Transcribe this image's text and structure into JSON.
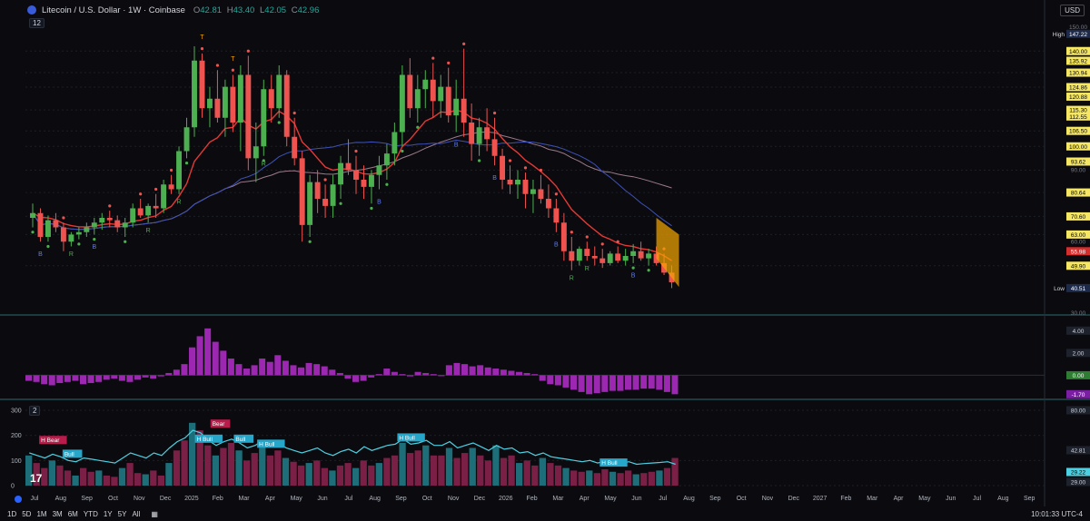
{
  "header": {
    "symbol_title": "Litecoin / U.S. Dollar · 1W · Coinbase",
    "ohlc": [
      {
        "label": "O",
        "value": "42.81"
      },
      {
        "label": "H",
        "value": "43.40"
      },
      {
        "label": "L",
        "value": "42.05"
      },
      {
        "label": "C",
        "value": "42.96"
      }
    ],
    "interval_count": "12",
    "currency": "USD"
  },
  "pane3_count": "2",
  "timeframes": [
    "1D",
    "5D",
    "1M",
    "3M",
    "6M",
    "YTD",
    "1Y",
    "5Y",
    "All"
  ],
  "clock": "10:01:33 UTC-4",
  "colors": {
    "up": "#4caf50",
    "down": "#ef5350",
    "ema_red": "#e53935",
    "sma_blue": "#3f51b5",
    "ema_mauve": "#9c7a8a",
    "osc_purple": "#9c27b0",
    "cyan": "#4dd0e1",
    "orange": "#f7a600"
  },
  "chart_data": [
    {
      "type": "line",
      "title": "Litecoin / U.S. Dollar · 1W · Coinbase",
      "x_tick_labels": [
        "Jul",
        "Aug",
        "Sep",
        "Oct",
        "Nov",
        "Dec",
        "2025",
        "Feb",
        "Mar",
        "Apr",
        "May",
        "Jun",
        "Jul",
        "Aug",
        "Sep",
        "Oct",
        "Nov",
        "Dec",
        "2026",
        "Feb",
        "Mar",
        "Apr",
        "May",
        "Jun",
        "Jul",
        "Aug",
        "Sep",
        "Oct",
        "Nov",
        "Dec",
        "2027",
        "Feb",
        "Mar",
        "Apr",
        "May",
        "Jun",
        "Jul",
        "Aug",
        "Sep"
      ],
      "y_tick_labels": [
        "150.00",
        "140.00",
        "130.94",
        "124.86",
        "115.30",
        "106.50",
        "100.00",
        "90.00",
        "80.64",
        "70.60",
        "63.00",
        "60.00",
        "55.98",
        "49.90",
        "40.51",
        "30.00"
      ],
      "ylim": [
        30,
        150
      ],
      "price_labels": [
        {
          "label": "High",
          "value": "147.22"
        },
        {
          "label": "",
          "value": "140.00"
        },
        {
          "label": "",
          "value": "135.92"
        },
        {
          "label": "",
          "value": "130.94"
        },
        {
          "label": "",
          "value": "124.86"
        },
        {
          "label": "",
          "value": "120.88"
        },
        {
          "label": "",
          "value": "115.30"
        },
        {
          "label": "",
          "value": "112.55"
        },
        {
          "label": "",
          "value": "106.50"
        },
        {
          "label": "",
          "value": "100.00"
        },
        {
          "label": "",
          "value": "93.62"
        },
        {
          "label": "",
          "value": "80.64"
        },
        {
          "label": "",
          "value": "70.60"
        },
        {
          "label": "",
          "value": "63.00"
        },
        {
          "label": "",
          "value": "55.98"
        },
        {
          "label": "",
          "value": "49.90"
        },
        {
          "label": "Low",
          "value": "40.51"
        }
      ],
      "series": [
        {
          "type": "candlestick",
          "candles": [
            [
              70,
              76,
              66,
              72
            ],
            [
              72,
              74,
              60,
              62
            ],
            [
              62,
              71,
              60,
              69
            ],
            [
              69,
              72,
              64,
              66
            ],
            [
              66,
              68,
              56,
              60
            ],
            [
              60,
              64,
              58,
              63
            ],
            [
              63,
              66,
              61,
              64
            ],
            [
              64,
              68,
              62,
              66
            ],
            [
              66,
              70,
              63,
              68
            ],
            [
              68,
              72,
              65,
              70
            ],
            [
              70,
              73,
              66,
              69
            ],
            [
              69,
              71,
              64,
              66
            ],
            [
              66,
              70,
              62,
              68
            ],
            [
              68,
              76,
              66,
              74
            ],
            [
              74,
              78,
              70,
              71
            ],
            [
              71,
              76,
              68,
              75
            ],
            [
              75,
              80,
              70,
              74
            ],
            [
              74,
              86,
              72,
              84
            ],
            [
              84,
              88,
              80,
              82
            ],
            [
              82,
              100,
              80,
              98
            ],
            [
              98,
              112,
              95,
              108
            ],
            [
              108,
              142,
              104,
              136
            ],
            [
              136,
              139,
              112,
              116
            ],
            [
              116,
              125,
              108,
              120
            ],
            [
              120,
              132,
              110,
              112
            ],
            [
              112,
              128,
              104,
              125
            ],
            [
              125,
              130,
              106,
              110
            ],
            [
              110,
              134,
              98,
              130
            ],
            [
              130,
              138,
              90,
              95
            ],
            [
              95,
              110,
              85,
              100
            ],
            [
              100,
              128,
              96,
              124
            ],
            [
              124,
              130,
              110,
              116
            ],
            [
              116,
              134,
              112,
              130
            ],
            [
              130,
              132,
              100,
              104
            ],
            [
              104,
              112,
              92,
              95
            ],
            [
              95,
              98,
              60,
              67
            ],
            [
              67,
              88,
              62,
              85
            ],
            [
              85,
              90,
              72,
              78
            ],
            [
              78,
              84,
              70,
              75
            ],
            [
              75,
              88,
              70,
              84
            ],
            [
              84,
              96,
              78,
              93
            ],
            [
              93,
              103,
              88,
              90
            ],
            [
              90,
              96,
              80,
              86
            ],
            [
              86,
              92,
              78,
              83
            ],
            [
              83,
              90,
              76,
              88
            ],
            [
              88,
              96,
              82,
              92
            ],
            [
              92,
              101,
              86,
              97
            ],
            [
              97,
              110,
              92,
              106
            ],
            [
              106,
              134,
              100,
              130
            ],
            [
              130,
              137,
              112,
              116
            ],
            [
              116,
              130,
              110,
              124
            ],
            [
              124,
              132,
              116,
              128
            ],
            [
              128,
              135,
              112,
              119
            ],
            [
              119,
              130,
              112,
              125
            ],
            [
              125,
              133,
              110,
              113
            ],
            [
              113,
              128,
              106,
              120
            ],
            [
              120,
              141,
              104,
              110
            ],
            [
              110,
              118,
              94,
              101
            ],
            [
              101,
              112,
              96,
              108
            ],
            [
              108,
              116,
              98,
              103
            ],
            [
              103,
              112,
              92,
              96
            ],
            [
              96,
              99,
              82,
              86
            ],
            [
              86,
              92,
              80,
              84
            ],
            [
              84,
              90,
              78,
              86
            ],
            [
              86,
              89,
              74,
              80
            ],
            [
              80,
              86,
              72,
              82
            ],
            [
              82,
              88,
              76,
              78
            ],
            [
              78,
              84,
              70,
              74
            ],
            [
              74,
              78,
              64,
              68
            ],
            [
              68,
              72,
              52,
              56
            ],
            [
              56,
              62,
              48,
              52
            ],
            [
              52,
              58,
              50,
              57
            ],
            [
              57,
              60,
              52,
              54
            ],
            [
              54,
              58,
              50,
              53
            ],
            [
              53,
              57,
              49,
              51
            ],
            [
              51,
              56,
              50,
              55
            ],
            [
              55,
              58,
              51,
              52
            ],
            [
              52,
              57,
              50,
              54
            ],
            [
              54,
              59,
              51,
              56
            ],
            [
              56,
              60,
              52,
              53
            ],
            [
              53,
              57,
              50,
              55
            ],
            [
              55,
              58,
              50,
              51
            ],
            [
              51,
              55,
              46,
              47
            ],
            [
              47,
              50,
              40.51,
              42.96
            ]
          ]
        },
        {
          "name": "EMA",
          "values": []
        },
        {
          "name": "SMA",
          "values": []
        }
      ],
      "annotations": [
        "R",
        "T",
        "R",
        "B",
        "R",
        "B",
        "B",
        "B",
        "R",
        "B",
        "R",
        "T",
        "B",
        "B",
        "R"
      ]
    },
    {
      "type": "bar",
      "y_tick_labels": [
        "4.00",
        "2.00",
        "0.00",
        "-1.70"
      ],
      "ylim": [
        -2,
        5
      ],
      "values": [
        -0.5,
        -0.6,
        -0.8,
        -0.9,
        -0.7,
        -0.6,
        -0.5,
        -0.8,
        -0.7,
        -0.6,
        -0.4,
        -0.3,
        -0.5,
        -0.6,
        -0.4,
        -0.2,
        -0.3,
        -0.1,
        0.2,
        0.5,
        1.0,
        2.5,
        3.5,
        4.2,
        3.0,
        2.2,
        1.5,
        1.0,
        0.6,
        0.9,
        1.5,
        1.2,
        1.8,
        1.3,
        0.9,
        0.7,
        1.1,
        1.0,
        0.8,
        0.5,
        0.2,
        -0.3,
        -0.6,
        -0.5,
        -0.2,
        0.1,
        0.6,
        0.3,
        0.1,
        -0.1,
        0.3,
        0.2,
        0.1,
        0.0,
        0.9,
        1.1,
        1.0,
        0.8,
        0.9,
        0.7,
        0.6,
        0.5,
        0.4,
        0.3,
        0.2,
        0.1,
        -0.5,
        -0.8,
        -0.9,
        -1.1,
        -1.3,
        -1.5,
        -1.7,
        -1.6,
        -1.5,
        -1.4,
        -1.4,
        -1.3,
        -1.3,
        -1.2,
        -1.2,
        -1.3,
        -1.5,
        -1.7
      ]
    },
    {
      "type": "bar",
      "y_tick_labels": [
        "80.00",
        "42.81",
        "29.22",
        "29.00"
      ],
      "y_tick_labels_left": [
        "300",
        "200",
        "100",
        "0"
      ],
      "ylim": [
        0,
        300
      ],
      "labels": [
        "H Bear",
        "Bull",
        "Bear",
        "H Bull",
        "Bull",
        "H Bull",
        "H Bull",
        "H Bull"
      ],
      "values": [
        120,
        90,
        70,
        100,
        80,
        60,
        40,
        70,
        55,
        60,
        40,
        35,
        70,
        90,
        50,
        45,
        60,
        40,
        90,
        140,
        180,
        250,
        220,
        160,
        120,
        150,
        170,
        140,
        100,
        130,
        160,
        120,
        140,
        110,
        95,
        80,
        90,
        100,
        70,
        60,
        80,
        90,
        70,
        100,
        80,
        90,
        110,
        120,
        170,
        130,
        140,
        160,
        120,
        120,
        150,
        110,
        130,
        150,
        120,
        100,
        160,
        110,
        120,
        90,
        100,
        80,
        110,
        90,
        80,
        70,
        60,
        55,
        60,
        50,
        65,
        55,
        50,
        60,
        45,
        50,
        55,
        60,
        70,
        110
      ],
      "line": [
        130,
        120,
        110,
        125,
        115,
        100,
        95,
        110,
        105,
        100,
        95,
        90,
        110,
        130,
        120,
        110,
        130,
        120,
        150,
        175,
        190,
        220,
        210,
        180,
        160,
        175,
        185,
        170,
        150,
        160,
        180,
        160,
        170,
        150,
        140,
        130,
        140,
        150,
        130,
        120,
        135,
        145,
        130,
        155,
        140,
        150,
        160,
        165,
        185,
        165,
        170,
        180,
        160,
        160,
        175,
        150,
        160,
        170,
        155,
        140,
        160,
        145,
        150,
        130,
        135,
        120,
        130,
        115,
        110,
        105,
        100,
        95,
        100,
        90,
        98,
        92,
        88,
        95,
        85,
        88,
        90,
        92,
        95,
        85
      ]
    }
  ]
}
